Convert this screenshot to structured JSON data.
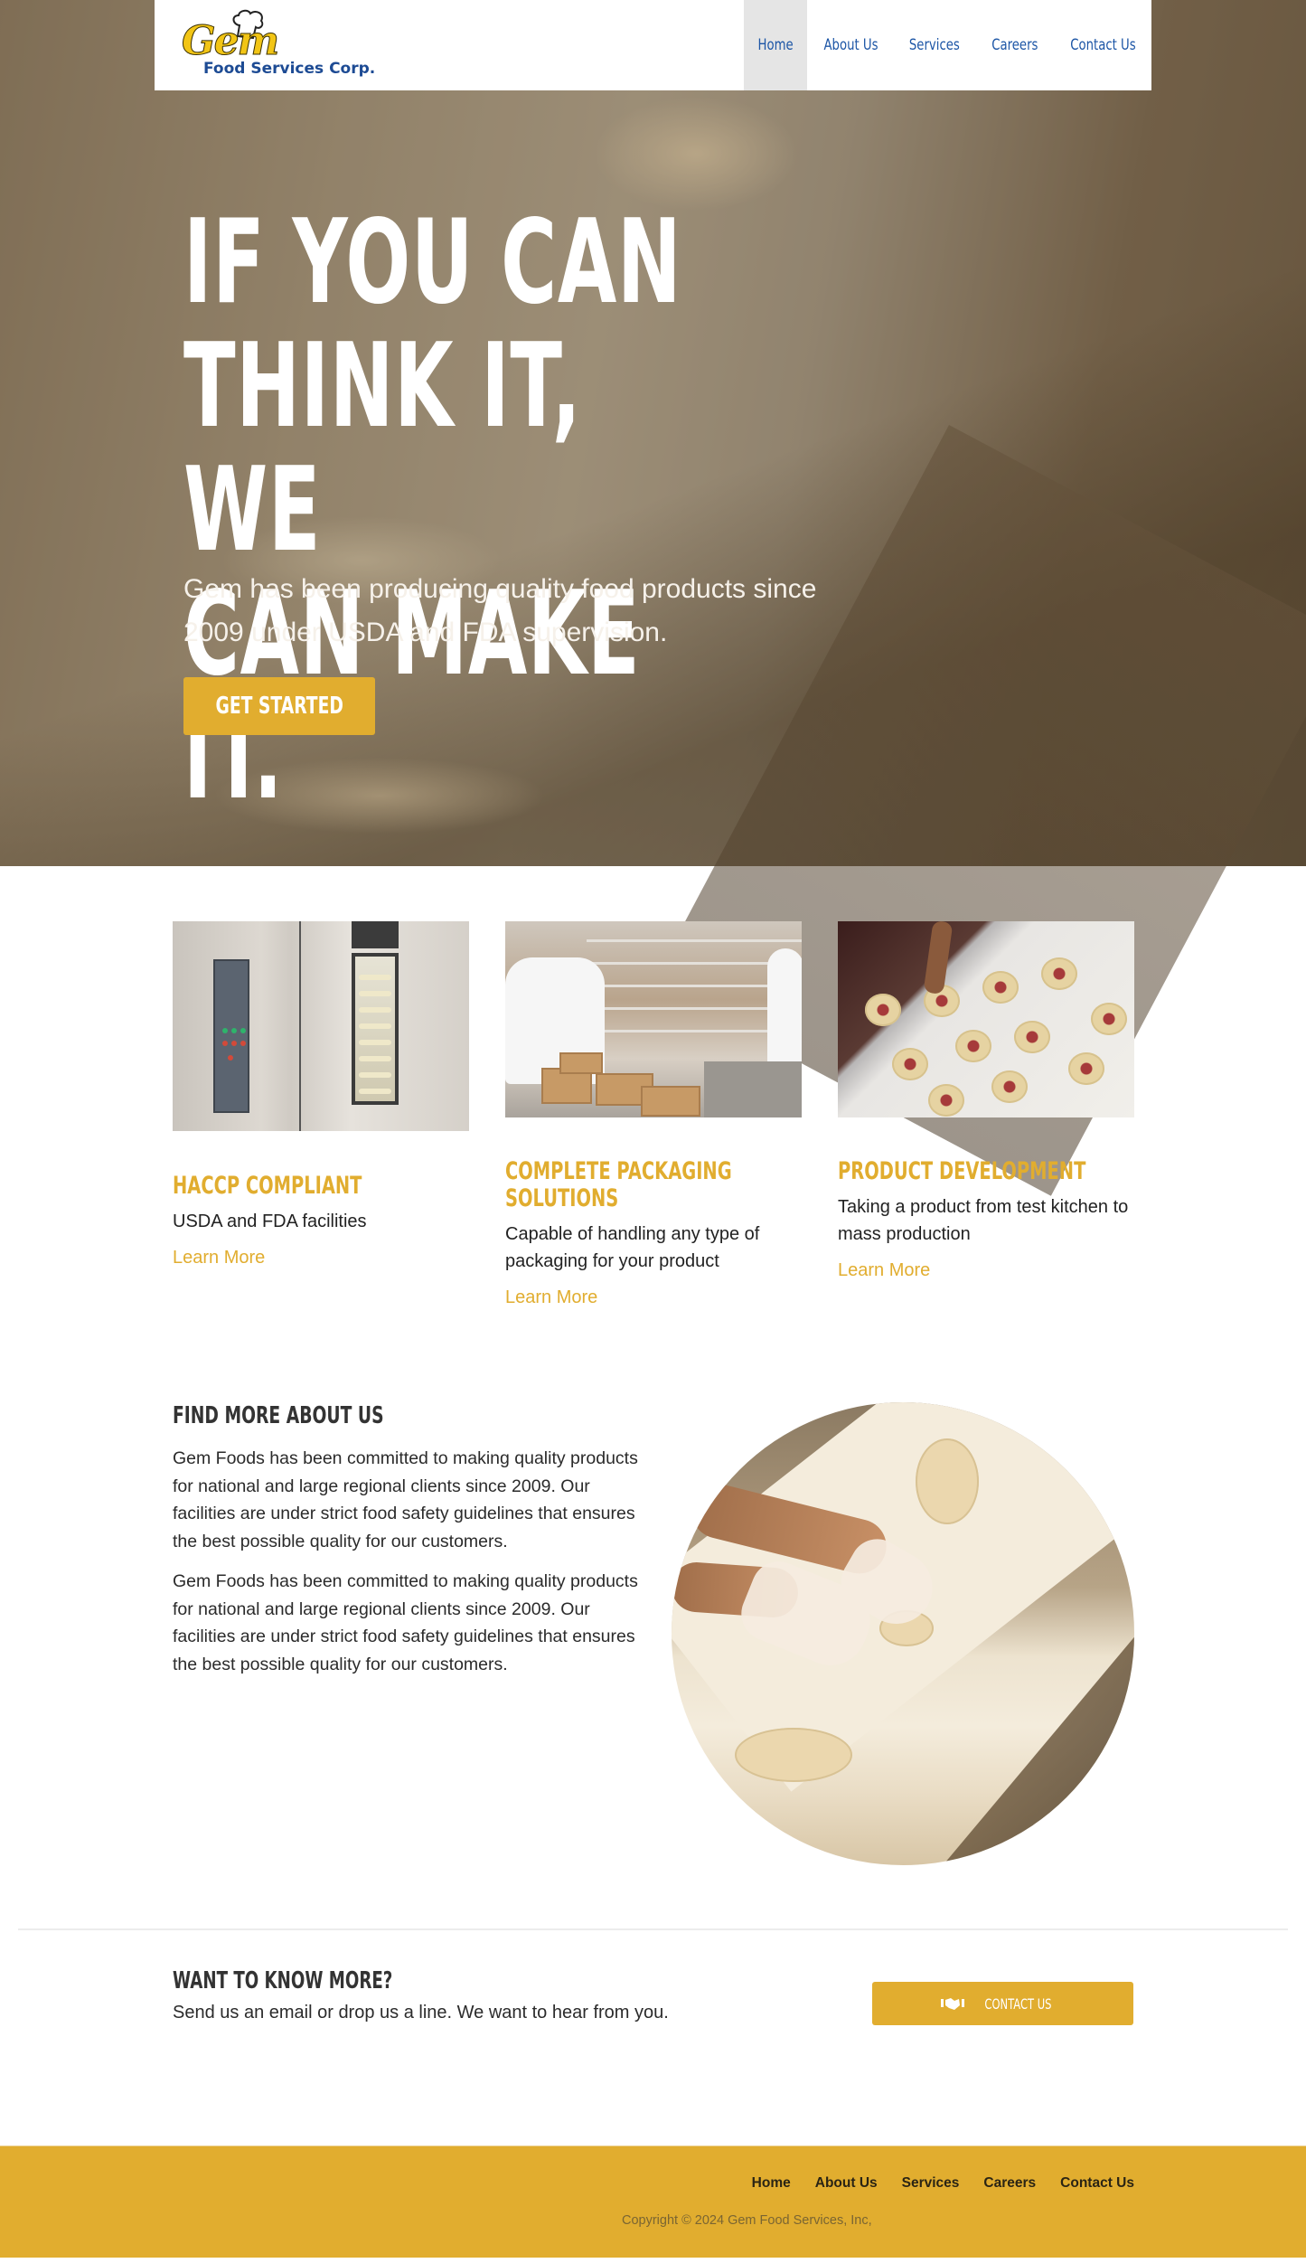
{
  "header": {
    "logo": {
      "script_text": "Gem",
      "company_text": "Food Services Corp.",
      "icon": "chef-hat-icon"
    },
    "nav": [
      {
        "label": "Home",
        "active": true
      },
      {
        "label": "About Us",
        "active": false
      },
      {
        "label": "Services",
        "active": false
      },
      {
        "label": "Careers",
        "active": false
      },
      {
        "label": "Contact Us",
        "active": false
      }
    ]
  },
  "hero": {
    "title_lines": [
      "IF YOU CAN",
      "THINK IT, WE",
      "CAN MAKE IT."
    ],
    "subtitle": "Gem has been producing quality food products since 2009 under USDA and FDA supervision.",
    "cta_label": "GET STARTED"
  },
  "features": [
    {
      "title": "HACCP COMPLIANT",
      "description": "USDA and FDA facilities",
      "link": "Learn More",
      "image": "industrial-oven-photo"
    },
    {
      "title": "COMPLETE PACKAGING SOLUTIONS",
      "description": "Capable of handling any type of packaging for your product",
      "link": "Learn More",
      "image": "packaging-workers-photo"
    },
    {
      "title": "PRODUCT DEVELOPMENT",
      "description": "Taking a product from test kitchen to mass production",
      "link": "Learn More",
      "image": "pastry-tray-photo"
    }
  ],
  "about": {
    "title": "FIND MORE ABOUT US",
    "paragraphs": [
      "Gem Foods has been committed to making quality products for national and large regional clients since 2009. Our facilities are under strict food safety guidelines that ensures the best possible quality for our customers.",
      "Gem Foods has been committed to making quality products for national and large regional clients since 2009. Our facilities are under strict food safety guidelines that ensures the best possible quality for our customers."
    ],
    "image": "dough-preparation-photo"
  },
  "cta": {
    "title": "WANT TO KNOW MORE?",
    "text": "Send us an email or drop us a line. We want to hear from you.",
    "button_label": "CONTACT US",
    "button_icon": "handshake-icon"
  },
  "footer": {
    "nav": [
      "Home",
      "About Us",
      "Services",
      "Careers",
      "Contact Us"
    ],
    "copyright": "Copyright © 2024 Gem Food Services, Inc,"
  },
  "colors": {
    "accent": "#e1ad2f",
    "nav_link": "#1d56a6",
    "heading_dark": "#333333",
    "nav_active_bg": "#e5e5e5"
  }
}
